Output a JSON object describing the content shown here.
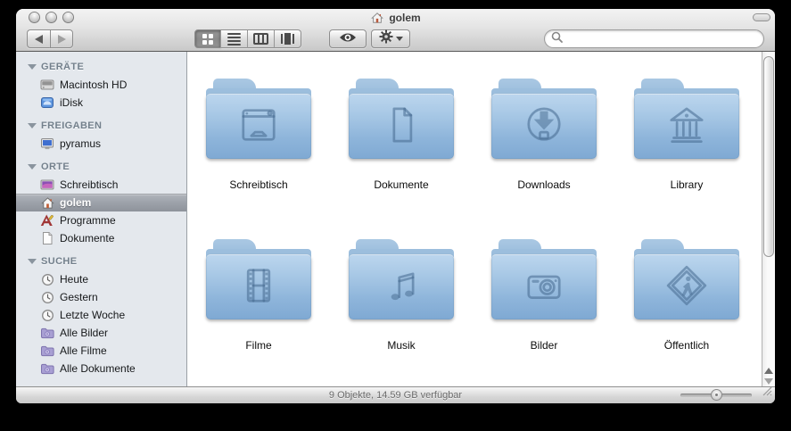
{
  "window": {
    "title": "golem",
    "title_icon": "home-icon",
    "controls": [
      "close-button",
      "minimize-button",
      "zoom-button"
    ]
  },
  "toolbar": {
    "back_icon": "back-arrow-icon",
    "forward_icon": "forward-arrow-icon",
    "view_modes": [
      "icon-view",
      "list-view",
      "column-view",
      "coverflow-view"
    ],
    "view_mode_selected": "icon-view",
    "quicklook_icon": "eye-icon",
    "action_icon": "gear-icon",
    "search": {
      "value": "",
      "placeholder": "",
      "icon": "magnifier-icon"
    }
  },
  "sidebar": {
    "sections": [
      {
        "header": "GERÄTE",
        "items": [
          {
            "label": "Macintosh HD",
            "icon": "hard-drive-icon",
            "selected": false
          },
          {
            "label": "iDisk",
            "icon": "idisk-icon",
            "selected": false
          }
        ]
      },
      {
        "header": "FREIGABEN",
        "items": [
          {
            "label": "pyramus",
            "icon": "shared-display-icon",
            "selected": false
          }
        ]
      },
      {
        "header": "ORTE",
        "items": [
          {
            "label": "Schreibtisch",
            "icon": "desktop-icon",
            "selected": false
          },
          {
            "label": "golem",
            "icon": "home-icon",
            "selected": true
          },
          {
            "label": "Programme",
            "icon": "applications-icon",
            "selected": false
          },
          {
            "label": "Dokumente",
            "icon": "document-icon",
            "selected": false
          }
        ]
      },
      {
        "header": "SUCHE",
        "items": [
          {
            "label": "Heute",
            "icon": "clock-icon",
            "selected": false
          },
          {
            "label": "Gestern",
            "icon": "clock-icon",
            "selected": false
          },
          {
            "label": "Letzte Woche",
            "icon": "clock-icon",
            "selected": false
          },
          {
            "label": "Alle Bilder",
            "icon": "smart-folder-icon",
            "selected": false
          },
          {
            "label": "Alle Filme",
            "icon": "smart-folder-icon",
            "selected": false
          },
          {
            "label": "Alle Dokumente",
            "icon": "smart-folder-icon",
            "selected": false
          }
        ]
      }
    ]
  },
  "content": {
    "folders": [
      {
        "name": "Schreibtisch",
        "glyph": "desktop-glyph"
      },
      {
        "name": "Dokumente",
        "glyph": "document-glyph"
      },
      {
        "name": "Downloads",
        "glyph": "download-arrow-glyph"
      },
      {
        "name": "Library",
        "glyph": "library-building-glyph"
      },
      {
        "name": "Filme",
        "glyph": "filmstrip-glyph"
      },
      {
        "name": "Musik",
        "glyph": "music-note-glyph"
      },
      {
        "name": "Bilder",
        "glyph": "camera-glyph"
      },
      {
        "name": "Öffentlich",
        "glyph": "crossing-sign-glyph"
      }
    ]
  },
  "statusbar": {
    "text": "9 Objekte, 14.59 GB verfügbar"
  },
  "colors": {
    "folder_blue_top": "#bcd6ee",
    "folder_blue_bottom": "#7fa9d3",
    "folder_glyph": "#6d92b8",
    "sidebar_bg": "#e4e8ed",
    "selection_gray_top": "#b2b6bd",
    "selection_gray_bottom": "#8e939b",
    "header_gradient_top": "#f3f3f3",
    "header_gradient_bottom": "#c8c8c8"
  }
}
